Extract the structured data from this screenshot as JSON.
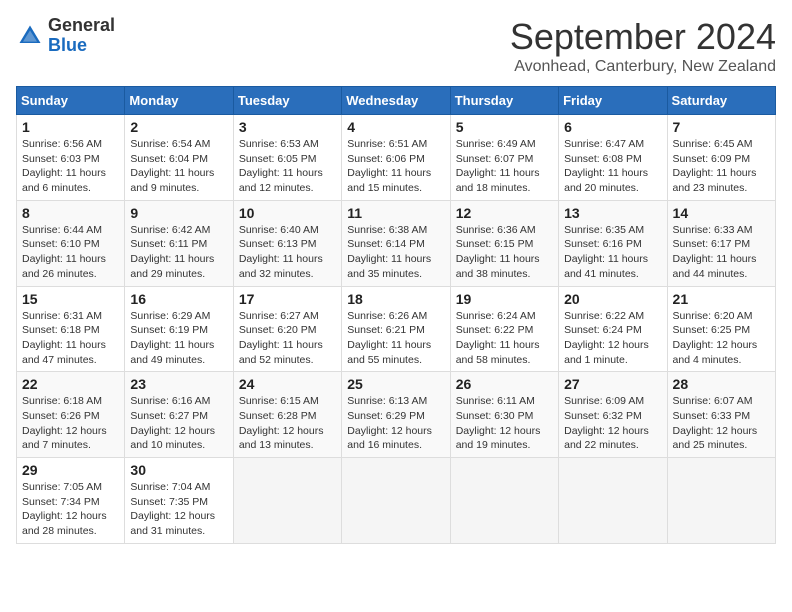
{
  "logo": {
    "general": "General",
    "blue": "Blue"
  },
  "header": {
    "month": "September 2024",
    "location": "Avonhead, Canterbury, New Zealand"
  },
  "weekdays": [
    "Sunday",
    "Monday",
    "Tuesday",
    "Wednesday",
    "Thursday",
    "Friday",
    "Saturday"
  ],
  "weeks": [
    [
      {
        "day": "1",
        "sunrise": "6:56 AM",
        "sunset": "6:03 PM",
        "daylight": "11 hours and 6 minutes."
      },
      {
        "day": "2",
        "sunrise": "6:54 AM",
        "sunset": "6:04 PM",
        "daylight": "11 hours and 9 minutes."
      },
      {
        "day": "3",
        "sunrise": "6:53 AM",
        "sunset": "6:05 PM",
        "daylight": "11 hours and 12 minutes."
      },
      {
        "day": "4",
        "sunrise": "6:51 AM",
        "sunset": "6:06 PM",
        "daylight": "11 hours and 15 minutes."
      },
      {
        "day": "5",
        "sunrise": "6:49 AM",
        "sunset": "6:07 PM",
        "daylight": "11 hours and 18 minutes."
      },
      {
        "day": "6",
        "sunrise": "6:47 AM",
        "sunset": "6:08 PM",
        "daylight": "11 hours and 20 minutes."
      },
      {
        "day": "7",
        "sunrise": "6:45 AM",
        "sunset": "6:09 PM",
        "daylight": "11 hours and 23 minutes."
      }
    ],
    [
      {
        "day": "8",
        "sunrise": "6:44 AM",
        "sunset": "6:10 PM",
        "daylight": "11 hours and 26 minutes."
      },
      {
        "day": "9",
        "sunrise": "6:42 AM",
        "sunset": "6:11 PM",
        "daylight": "11 hours and 29 minutes."
      },
      {
        "day": "10",
        "sunrise": "6:40 AM",
        "sunset": "6:13 PM",
        "daylight": "11 hours and 32 minutes."
      },
      {
        "day": "11",
        "sunrise": "6:38 AM",
        "sunset": "6:14 PM",
        "daylight": "11 hours and 35 minutes."
      },
      {
        "day": "12",
        "sunrise": "6:36 AM",
        "sunset": "6:15 PM",
        "daylight": "11 hours and 38 minutes."
      },
      {
        "day": "13",
        "sunrise": "6:35 AM",
        "sunset": "6:16 PM",
        "daylight": "11 hours and 41 minutes."
      },
      {
        "day": "14",
        "sunrise": "6:33 AM",
        "sunset": "6:17 PM",
        "daylight": "11 hours and 44 minutes."
      }
    ],
    [
      {
        "day": "15",
        "sunrise": "6:31 AM",
        "sunset": "6:18 PM",
        "daylight": "11 hours and 47 minutes."
      },
      {
        "day": "16",
        "sunrise": "6:29 AM",
        "sunset": "6:19 PM",
        "daylight": "11 hours and 49 minutes."
      },
      {
        "day": "17",
        "sunrise": "6:27 AM",
        "sunset": "6:20 PM",
        "daylight": "11 hours and 52 minutes."
      },
      {
        "day": "18",
        "sunrise": "6:26 AM",
        "sunset": "6:21 PM",
        "daylight": "11 hours and 55 minutes."
      },
      {
        "day": "19",
        "sunrise": "6:24 AM",
        "sunset": "6:22 PM",
        "daylight": "11 hours and 58 minutes."
      },
      {
        "day": "20",
        "sunrise": "6:22 AM",
        "sunset": "6:24 PM",
        "daylight": "12 hours and 1 minute."
      },
      {
        "day": "21",
        "sunrise": "6:20 AM",
        "sunset": "6:25 PM",
        "daylight": "12 hours and 4 minutes."
      }
    ],
    [
      {
        "day": "22",
        "sunrise": "6:18 AM",
        "sunset": "6:26 PM",
        "daylight": "12 hours and 7 minutes."
      },
      {
        "day": "23",
        "sunrise": "6:16 AM",
        "sunset": "6:27 PM",
        "daylight": "12 hours and 10 minutes."
      },
      {
        "day": "24",
        "sunrise": "6:15 AM",
        "sunset": "6:28 PM",
        "daylight": "12 hours and 13 minutes."
      },
      {
        "day": "25",
        "sunrise": "6:13 AM",
        "sunset": "6:29 PM",
        "daylight": "12 hours and 16 minutes."
      },
      {
        "day": "26",
        "sunrise": "6:11 AM",
        "sunset": "6:30 PM",
        "daylight": "12 hours and 19 minutes."
      },
      {
        "day": "27",
        "sunrise": "6:09 AM",
        "sunset": "6:32 PM",
        "daylight": "12 hours and 22 minutes."
      },
      {
        "day": "28",
        "sunrise": "6:07 AM",
        "sunset": "6:33 PM",
        "daylight": "12 hours and 25 minutes."
      }
    ],
    [
      {
        "day": "29",
        "sunrise": "7:05 AM",
        "sunset": "7:34 PM",
        "daylight": "12 hours and 28 minutes."
      },
      {
        "day": "30",
        "sunrise": "7:04 AM",
        "sunset": "7:35 PM",
        "daylight": "12 hours and 31 minutes."
      },
      null,
      null,
      null,
      null,
      null
    ]
  ],
  "labels": {
    "sunrise": "Sunrise:",
    "sunset": "Sunset:",
    "daylight": "Daylight:"
  }
}
